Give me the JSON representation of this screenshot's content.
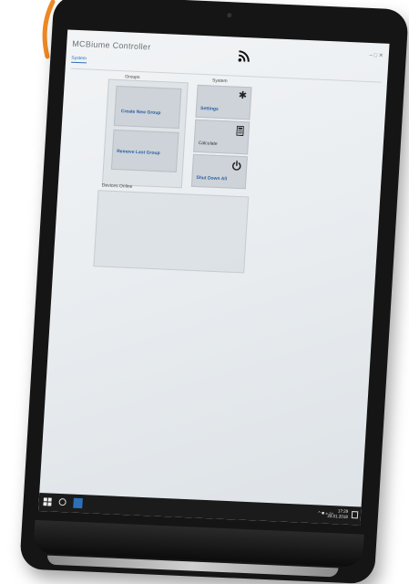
{
  "app": {
    "title": "MCBiume Controller",
    "window_controls": "–  □  ✕"
  },
  "tabs": [
    {
      "label": "System"
    }
  ],
  "groups": {
    "label": "Groups",
    "create_label": "Create New Group",
    "remove_label": "Remove Last Group"
  },
  "system": {
    "label": "System",
    "settings_label": "Settings",
    "calculate_label": "Calculate",
    "shutdown_label": "Shut Down All"
  },
  "devices": {
    "label": "Devices Online"
  },
  "taskbar": {
    "tray_icons": "^ ■ ⁎ ▭",
    "time": "17:29",
    "date": "23.01.2018"
  },
  "colors": {
    "signal": "#f08a24",
    "accent": "#2b5fa5"
  },
  "icons": {
    "rss": "rss-icon",
    "settings": "gear-icon",
    "calculate": "calculator-icon",
    "shutdown": "power-icon"
  }
}
